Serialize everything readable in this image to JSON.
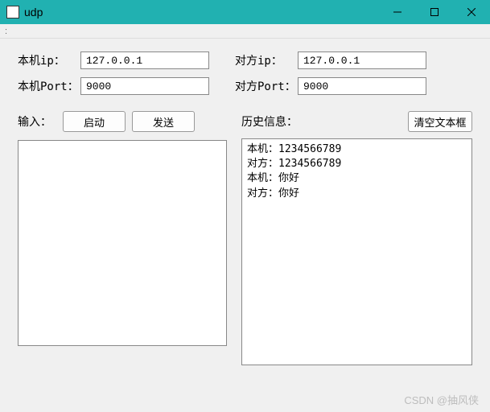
{
  "window": {
    "title": "udp",
    "menu_hint": ":"
  },
  "form": {
    "local_ip_label": "本机ip：",
    "local_ip_value": "127.0.0.1",
    "remote_ip_label": "对方ip：",
    "remote_ip_value": "127.0.0.1",
    "local_port_label": "本机Port：",
    "local_port_value": "9000",
    "remote_port_label": "对方Port：",
    "remote_port_value": "9000"
  },
  "input_section": {
    "label": "输入：",
    "start_btn": "启动",
    "send_btn": "发送",
    "value": ""
  },
  "history_section": {
    "label": "历史信息：",
    "clear_btn": "清空文本框",
    "content": "本机：1234566789\n对方：1234566789\n本机：你好\n对方：你好"
  },
  "watermark": "CSDN @抽风侠"
}
